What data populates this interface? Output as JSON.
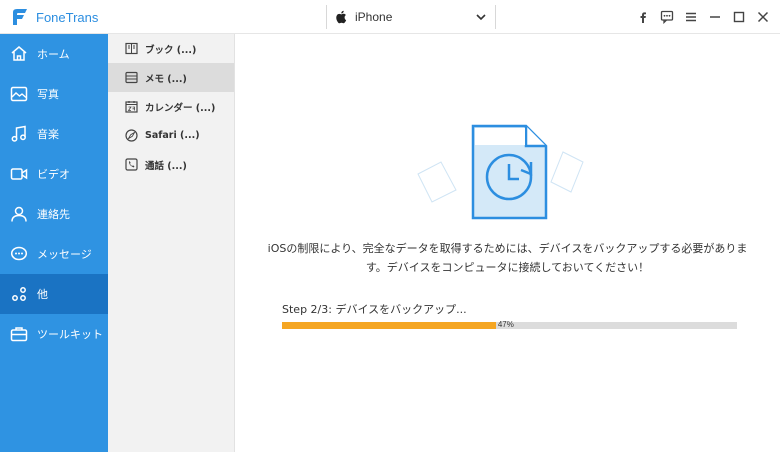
{
  "app": {
    "name": "FoneTrans"
  },
  "device": {
    "name": "iPhone"
  },
  "window_controls": [
    "facebook-icon",
    "feedback-icon",
    "menu-icon",
    "minimize-icon",
    "maximize-icon",
    "close-icon"
  ],
  "sidebar": {
    "active_index": 6,
    "items": [
      {
        "label": "ホーム",
        "icon": "home-icon"
      },
      {
        "label": "写真",
        "icon": "photo-icon"
      },
      {
        "label": "音楽",
        "icon": "music-icon"
      },
      {
        "label": "ビデオ",
        "icon": "video-icon"
      },
      {
        "label": "連絡先",
        "icon": "contacts-icon"
      },
      {
        "label": "メッセージ",
        "icon": "message-icon"
      },
      {
        "label": "他",
        "icon": "other-icon"
      },
      {
        "label": "ツールキット",
        "icon": "toolkit-icon"
      }
    ]
  },
  "subpanel": {
    "active_index": 1,
    "items": [
      {
        "label": "ブック (...)",
        "icon": "book-icon"
      },
      {
        "label": "メモ (...)",
        "icon": "note-icon"
      },
      {
        "label": "カレンダー (...)",
        "icon": "calendar-icon"
      },
      {
        "label": "Safari (...)",
        "icon": "safari-icon"
      },
      {
        "label": "通話 (...)",
        "icon": "phone-icon"
      }
    ]
  },
  "main": {
    "message_line1": "iOSの制限により、完全なデータを取得するためには、デバイスをバックアップする必要がありま",
    "message_line2": "す。デバイスをコンピュータに接続しておいてください！",
    "step_text": "Step 2/3: デバイスをバックアップ...",
    "progress": {
      "value": 0.47,
      "label": "47%"
    }
  },
  "colors": {
    "sidebar": "#2f93e2",
    "sidebar_active": "#1a73c3",
    "accent": "#2c8ee0",
    "progress_fill": "#f5a623",
    "progress_track": "#dcdcdc"
  }
}
